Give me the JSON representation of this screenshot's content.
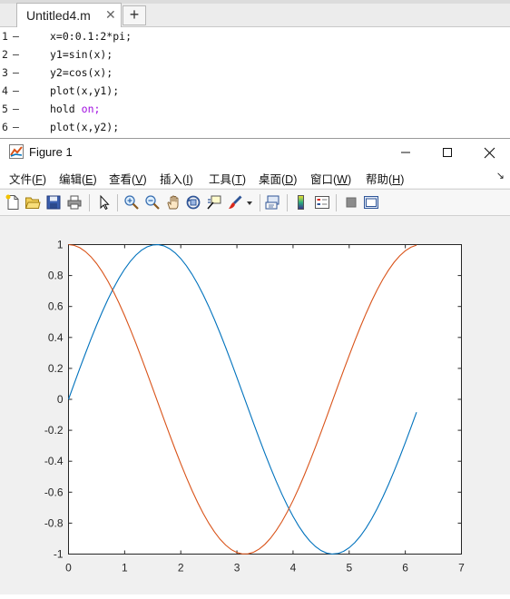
{
  "editor": {
    "tab_label": "Untitled4.m",
    "tab_close": "✕",
    "add_tab": "+",
    "lines": [
      {
        "num": "1",
        "dash": "–",
        "code": "x=0:0.1:2*pi;"
      },
      {
        "num": "2",
        "dash": "–",
        "code": "y1=sin(x);"
      },
      {
        "num": "3",
        "dash": "–",
        "code": "y2=cos(x);"
      },
      {
        "num": "4",
        "dash": "–",
        "code": "plot(x,y1);"
      },
      {
        "num": "5",
        "dash": "–",
        "code_kw": "hold",
        "code_arg": "on;"
      },
      {
        "num": "6",
        "dash": "–",
        "code": "plot(x,y2);"
      }
    ]
  },
  "figure": {
    "title": "Figure 1",
    "menu": [
      {
        "label": "文件(",
        "key": "F",
        "end": ")"
      },
      {
        "label": "编辑(",
        "key": "E",
        "end": ")"
      },
      {
        "label": "查看(",
        "key": "V",
        "end": ")"
      },
      {
        "label": "插入(",
        "key": "I",
        "end": ")"
      },
      {
        "label": "工具(",
        "key": "T",
        "end": ")"
      },
      {
        "label": "桌面(",
        "key": "D",
        "end": ")"
      },
      {
        "label": "窗口(",
        "key": "W",
        "end": ")"
      },
      {
        "label": "帮助(",
        "key": "H",
        "end": ")"
      }
    ],
    "menu_more": "↘"
  },
  "chart_data": {
    "type": "line",
    "title": "",
    "xlabel": "",
    "ylabel": "",
    "xlim": [
      0,
      7
    ],
    "ylim": [
      -1,
      1
    ],
    "xticks": [
      "0",
      "1",
      "2",
      "3",
      "4",
      "5",
      "6",
      "7"
    ],
    "yticks": [
      "1",
      "0.8",
      "0.6",
      "0.4",
      "0.2",
      "0",
      "-0.2",
      "-0.4",
      "-0.6",
      "-0.8",
      "-1"
    ],
    "grid": false,
    "x": [
      0,
      0.1,
      0.2,
      0.3,
      0.4,
      0.5,
      0.6,
      0.7,
      0.8,
      0.9,
      1.0,
      1.1,
      1.2,
      1.3,
      1.4,
      1.5,
      1.6,
      1.7,
      1.8,
      1.9,
      2.0,
      2.1,
      2.2,
      2.3,
      2.4,
      2.5,
      2.6,
      2.7,
      2.8,
      2.9,
      3.0,
      3.1,
      3.2,
      3.3,
      3.4,
      3.5,
      3.6,
      3.7,
      3.8,
      3.9,
      4.0,
      4.1,
      4.2,
      4.3,
      4.4,
      4.5,
      4.6,
      4.7,
      4.8,
      4.9,
      5.0,
      5.1,
      5.2,
      5.3,
      5.4,
      5.5,
      5.6,
      5.7,
      5.8,
      5.9,
      6.0,
      6.1,
      6.2
    ],
    "series": [
      {
        "color": "#0072bd",
        "values": [
          0,
          0.0998,
          0.1987,
          0.2955,
          0.3894,
          0.4794,
          0.5646,
          0.6442,
          0.7174,
          0.7833,
          0.8415,
          0.8912,
          0.932,
          0.9636,
          0.9854,
          0.9975,
          0.9996,
          0.9917,
          0.9738,
          0.9463,
          0.9093,
          0.8632,
          0.8085,
          0.7457,
          0.6755,
          0.5985,
          0.5155,
          0.4274,
          0.335,
          0.2392,
          0.1411,
          0.0416,
          -0.0584,
          -0.1577,
          -0.2555,
          -0.3508,
          -0.4425,
          -0.5298,
          -0.6119,
          -0.6878,
          -0.7568,
          -0.8183,
          -0.8716,
          -0.9162,
          -0.9516,
          -0.9775,
          -0.9937,
          -0.9999,
          -0.9962,
          -0.9825,
          -0.9589,
          -0.9258,
          -0.8835,
          -0.8323,
          -0.7728,
          -0.7055,
          -0.6313,
          -0.5507,
          -0.4646,
          -0.3739,
          -0.2794,
          -0.1822,
          -0.0831
        ]
      },
      {
        "color": "#d95319",
        "values": [
          1,
          0.995,
          0.9801,
          0.9553,
          0.9211,
          0.8776,
          0.8253,
          0.7648,
          0.6967,
          0.6216,
          0.5403,
          0.4536,
          0.3624,
          0.2675,
          0.17,
          0.0707,
          -0.0292,
          -0.1288,
          -0.2272,
          -0.3233,
          -0.4161,
          -0.5048,
          -0.5885,
          -0.6663,
          -0.7374,
          -0.8011,
          -0.8569,
          -0.9041,
          -0.9422,
          -0.971,
          -0.99,
          -0.9991,
          -0.9983,
          -0.9875,
          -0.9668,
          -0.9365,
          -0.8968,
          -0.8481,
          -0.791,
          -0.7259,
          -0.6536,
          -0.5748,
          -0.4903,
          -0.4008,
          -0.3073,
          -0.2108,
          -0.1122,
          -0.0124,
          0.0875,
          0.1865,
          0.2837,
          0.378,
          0.4685,
          0.5544,
          0.6347,
          0.7087,
          0.7756,
          0.8347,
          0.8855,
          0.9275,
          0.9602,
          0.9833,
          0.9965
        ]
      }
    ]
  }
}
